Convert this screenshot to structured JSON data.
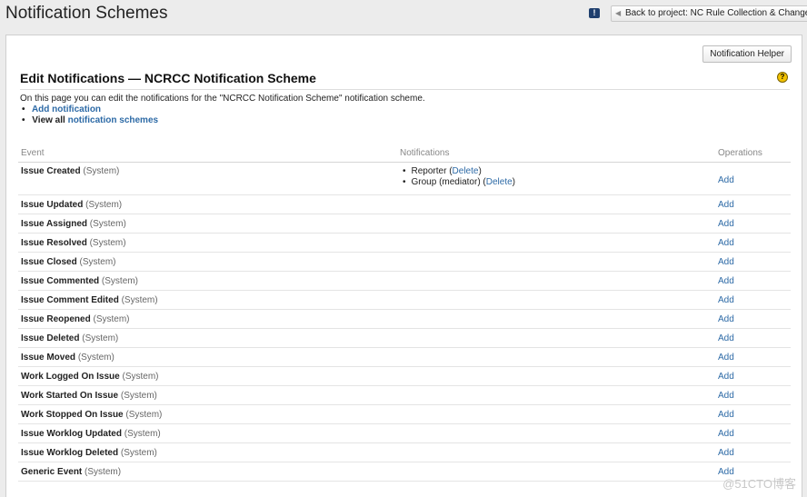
{
  "page": {
    "title": "Notification Schemes",
    "back_label": "Back to project: NC Rule Collection & Change",
    "helper_label": "Notification Helper",
    "heading": "Edit Notifications — NCRCC Notification Scheme",
    "intro": "On this page you can edit the notifications for the \"NCRCC Notification Scheme\" notification scheme.",
    "add_notification": "Add notification",
    "view_all_prefix": "View all",
    "view_all_link": "notification schemes",
    "help_icon_glyph": "?",
    "feedback_icon_glyph": "!",
    "watermark": "@51CTO博客"
  },
  "icons": {
    "feedback": "feedback-icon",
    "help": "help-icon",
    "back": "left-arrow-icon"
  },
  "table": {
    "headers": {
      "event": "Event",
      "notifications": "Notifications",
      "operations": "Operations"
    },
    "system_suffix": "(System)",
    "add_label": "Add",
    "rows": [
      {
        "event": "Issue Created",
        "notifications": [
          {
            "name": "Reporter",
            "action": "Delete"
          },
          {
            "name": "Group (mediator)",
            "action": "Delete"
          }
        ]
      },
      {
        "event": "Issue Updated"
      },
      {
        "event": "Issue Assigned"
      },
      {
        "event": "Issue Resolved"
      },
      {
        "event": "Issue Closed"
      },
      {
        "event": "Issue Commented"
      },
      {
        "event": "Issue Comment Edited"
      },
      {
        "event": "Issue Reopened"
      },
      {
        "event": "Issue Deleted"
      },
      {
        "event": "Issue Moved"
      },
      {
        "event": "Work Logged On Issue"
      },
      {
        "event": "Work Started On Issue"
      },
      {
        "event": "Work Stopped On Issue"
      },
      {
        "event": "Issue Worklog Updated"
      },
      {
        "event": "Issue Worklog Deleted"
      },
      {
        "event": "Generic Event"
      }
    ]
  }
}
